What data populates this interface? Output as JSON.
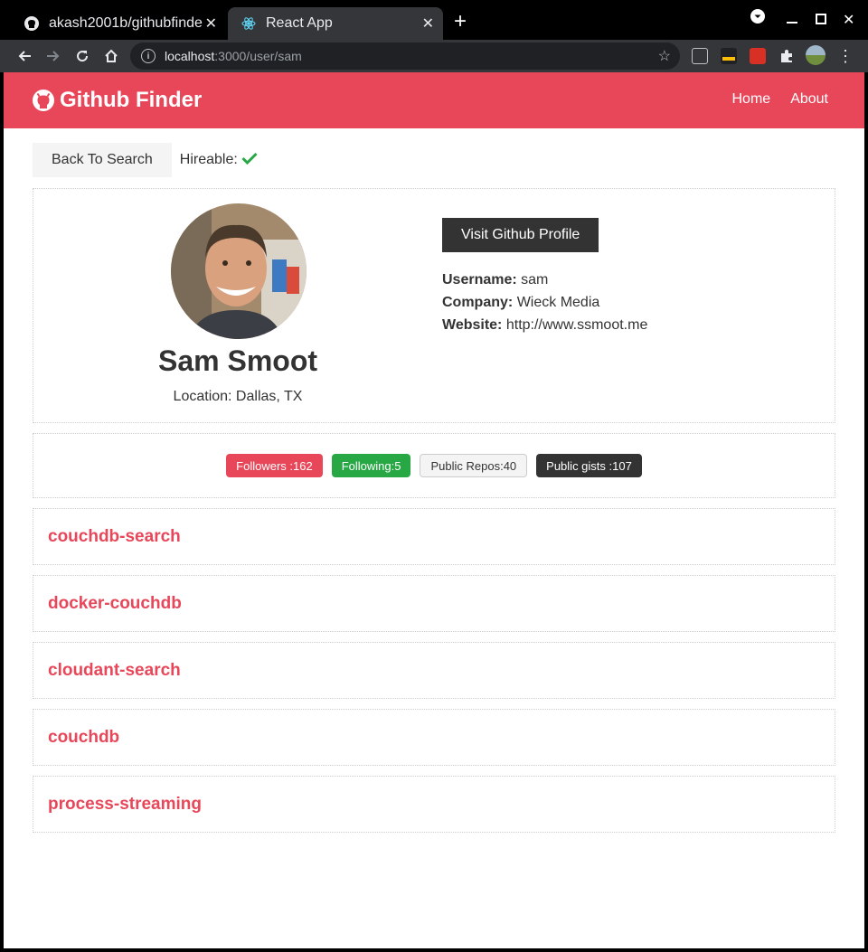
{
  "browser": {
    "tabs": [
      {
        "title": "akash2001b/githubfinde",
        "icon": "github-icon",
        "active": false
      },
      {
        "title": "React App",
        "icon": "react-icon",
        "active": true
      }
    ],
    "url_host": "localhost",
    "url_path": ":3000/user/sam"
  },
  "navbar": {
    "brand": "Github Finder",
    "links": [
      "Home",
      "About"
    ],
    "color": "#e8475a"
  },
  "page": {
    "back_label": "Back To Search",
    "hireable_label": "Hireable:",
    "hireable": true,
    "user": {
      "name": "Sam Smoot",
      "location": "Location: Dallas, TX",
      "visit_label": "Visit Github Profile",
      "username_label": "Username:",
      "username": "sam",
      "company_label": "Company:",
      "company": "Wieck Media",
      "website_label": "Website:",
      "website": "http://www.ssmoot.me"
    },
    "badges": {
      "followers": "Followers :162",
      "following": "Following:5",
      "repos": "Public Repos:40",
      "gists": "Public gists :107"
    },
    "repos": [
      "couchdb-search",
      "docker-couchdb",
      "cloudant-search",
      "couchdb",
      "process-streaming"
    ]
  }
}
